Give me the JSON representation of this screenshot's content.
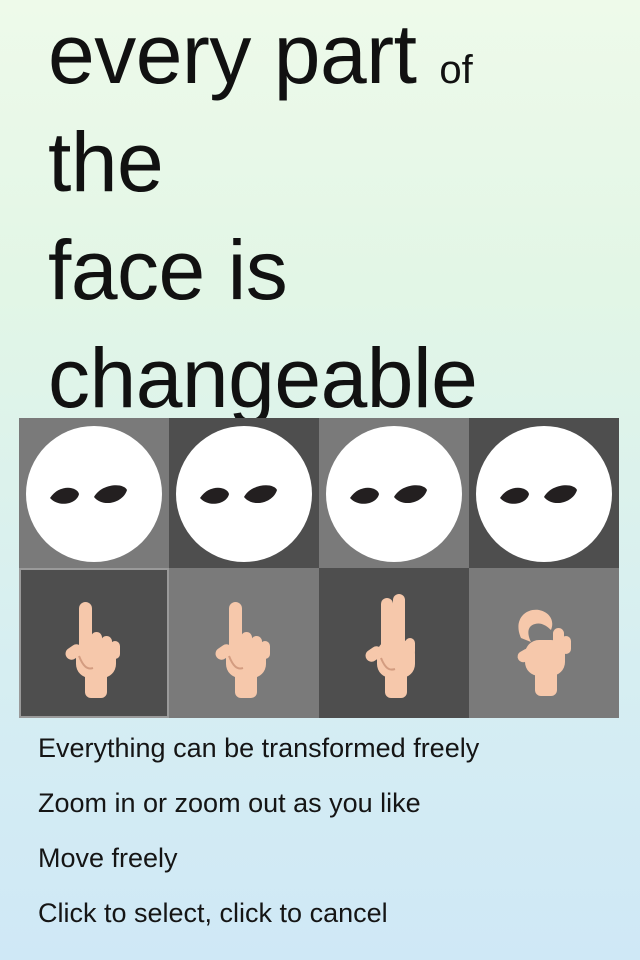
{
  "headline": {
    "line1_main": "every part",
    "line1_small": "of",
    "line2": "the",
    "line3": "face is",
    "line4": "changeable"
  },
  "colors": {
    "tile_light": "#7a7a7a",
    "tile_dark": "#4e4e4e",
    "face_white": "#ffffff",
    "eye": "#231f20",
    "hand_skin": "#f6c8ab"
  },
  "face_options": [
    {
      "icon": "face-with-eyes-icon"
    },
    {
      "icon": "face-with-eyes-icon"
    },
    {
      "icon": "face-with-eyes-icon"
    },
    {
      "icon": "face-with-eyes-icon"
    }
  ],
  "gesture_options": [
    {
      "icon": "index-finger-up-hand-icon",
      "selected": true
    },
    {
      "icon": "index-finger-up-hand-icon",
      "selected": false
    },
    {
      "icon": "two-fingers-up-hand-icon",
      "selected": false
    },
    {
      "icon": "curled-fingers-hand-icon",
      "selected": false
    }
  ],
  "features": [
    "Everything can be transformed freely",
    "Zoom in or zoom out as you like",
    "Move freely",
    "Click to select, click to cancel"
  ]
}
